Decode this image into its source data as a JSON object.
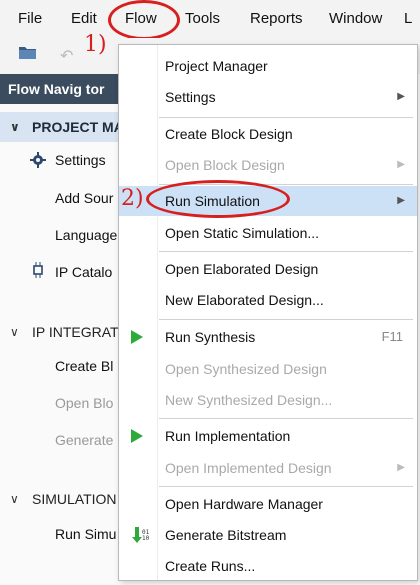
{
  "menubar": {
    "items": [
      {
        "label": "File",
        "u": "F"
      },
      {
        "label": "Edit",
        "u": "E"
      },
      {
        "label": "Flow",
        "u": "F"
      },
      {
        "label": "Tools",
        "u": "T"
      },
      {
        "label": "Reports",
        "u": "p"
      },
      {
        "label": "Window",
        "u": "W"
      },
      {
        "label": "L"
      }
    ]
  },
  "annotations": {
    "step1": "1)",
    "step2": "2)"
  },
  "navigator": {
    "header": "Flow Navig  tor",
    "sections": {
      "project": "PROJECT MA",
      "ip": "IP INTEGRAT",
      "sim": "SIMULATION"
    },
    "items": {
      "settings": "Settings",
      "add_sources": "Add Sour",
      "language": "Language",
      "ip_catalog": "IP Catalo",
      "create_block": "Create Bl",
      "open_block": "Open Blo",
      "generate": "Generate",
      "run_sim": "Run Simu"
    }
  },
  "menu": {
    "project_manager": "Project Manager",
    "settings": "Settings",
    "create_block": "Create Block Design",
    "open_block": "Open Block Design",
    "run_simulation": "Run Simulation",
    "open_static_sim": "Open Static Simulation...",
    "open_elab": "Open Elaborated Design",
    "new_elab": "New Elaborated Design...",
    "run_synth": "Run Synthesis",
    "run_synth_shortcut": "F11",
    "open_synth": "Open Synthesized Design",
    "new_synth": "New Synthesized Design...",
    "run_impl": "Run Implementation",
    "open_impl": "Open Implemented Design",
    "open_hw": "Open Hardware Manager",
    "gen_bitstream": "Generate Bitstream",
    "create_runs": "Create Runs..."
  },
  "colors": {
    "annotation": "#d6201f",
    "highlight": "#cce0f6",
    "run_icon": "#2eaa3b"
  }
}
